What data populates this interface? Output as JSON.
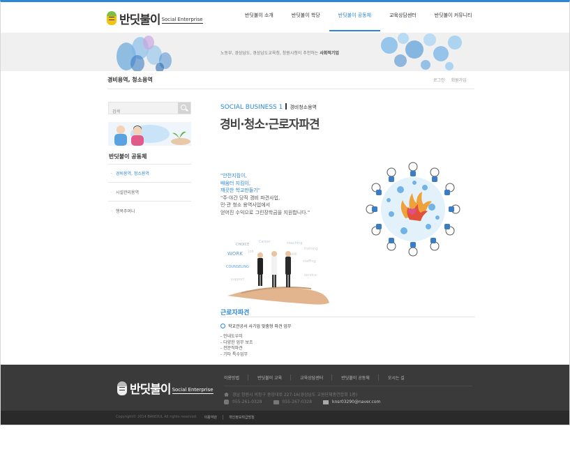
{
  "header": {
    "logo_text": "반딧불이",
    "logo_sub": "Social Enterprise",
    "nav": [
      "반딧불이 소개",
      "반딧불이 학당",
      "반딧불이 공동체",
      "교육상담센터",
      "반딧불이 커뮤니티"
    ],
    "active_nav_index": 2
  },
  "banner": {
    "text": "노동부, 경상남도, 경상남도교육청, 창원시청이 추천하는",
    "text_bold": "사회적기업"
  },
  "page": {
    "title": "경비용역, 청소용역",
    "util_links": [
      "로그인",
      "회원가입"
    ]
  },
  "sidebar": {
    "search_placeholder": "검색",
    "section_title": "반딧불이 공동체",
    "items": [
      {
        "label": "경비용역, 청소용역",
        "active": true
      },
      {
        "label": "시설관리용역",
        "active": false
      },
      {
        "label": "행복주머니",
        "active": false
      }
    ]
  },
  "content": {
    "kicker": "SOCIAL BUSINESS 1",
    "category": "경비청소용역",
    "title": "경비·청소·근로자파견",
    "quote_blue": [
      "\"안전지킴이,",
      "배움터 지킴이,",
      "깨끗한 학교만들기\""
    ],
    "quote_body": [
      "\"주·야간 당직 경비 파견사업,",
      "민·관 청소 용역사업에서",
      "얻어진 수익으로 그린장학금을 지원합니다.\""
    ],
    "sub_title": "근로자파견",
    "lead_item": "학교관공서 사기업 맞춤형 파견 업무",
    "list": [
      "- 안내도우미",
      "- 다양한 업무 보조",
      "- 전문직파견",
      "- 기타 특수업무"
    ]
  },
  "footer": {
    "logo_text": "반딧불이",
    "logo_sub": "Social Enterprise",
    "nav": [
      "이용방법",
      "반딧불이 교육",
      "교육상담센터",
      "반딧불이 공동체",
      "오시는 길"
    ],
    "address": "경남 창원시 의창구 중앙대로 227-16(경상남도 교원단체총연합회 1층)",
    "phone": "055-261-0328",
    "fax": "055-267-0328",
    "email": "knsr03290@naver.com",
    "copyright": "Copyright© 2014 BANDIUL All rights reserved.",
    "links": [
      "이용약관",
      "개인정보취급방침"
    ]
  },
  "colors": {
    "accent": "#2b86d6",
    "footer_bg": "#3a3a3a",
    "footer_bottom_bg": "#2a2a2a"
  }
}
